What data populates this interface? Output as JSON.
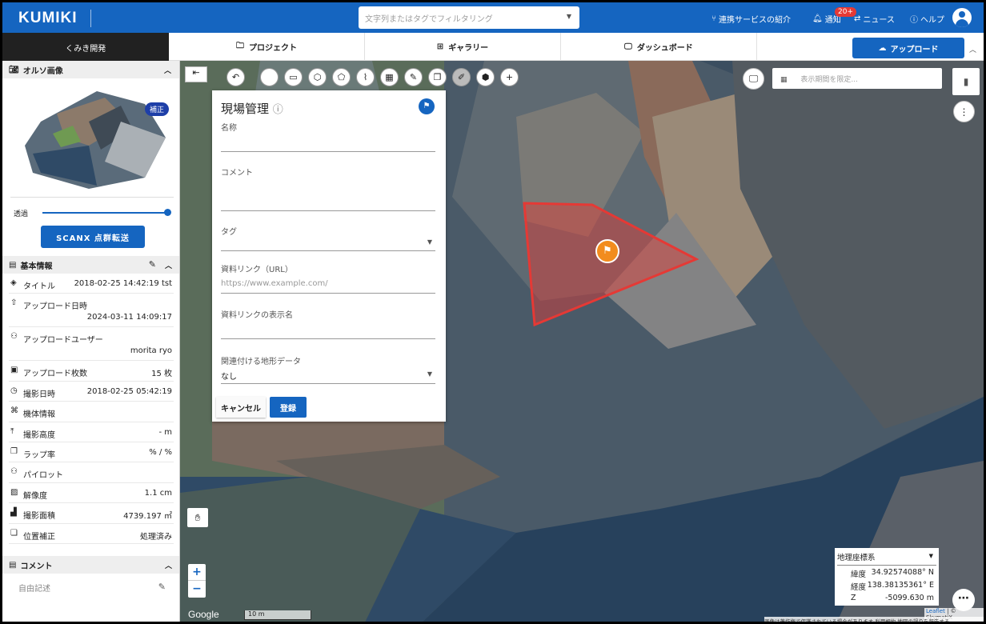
{
  "header": {
    "logo": "KUMIKI",
    "search_placeholder": "文字列またはタグでフィルタリング",
    "links": {
      "services": "連携サービスの紹介",
      "notify": "通知",
      "notify_badge": "20+",
      "news": "ニュース",
      "help": "ヘルプ"
    }
  },
  "nav": {
    "workspace": "くみき開発",
    "tabs": [
      "プロジェクト",
      "ギャラリー",
      "ダッシュボード"
    ],
    "upload": "アップロード"
  },
  "sidebar": {
    "ortho_title": "オルソ画像",
    "ortho_badge": "補正",
    "opacity_label": "透過",
    "opacity_value": 1.0,
    "scanx_label": "SCANX 点群転送",
    "info_title": "基本情報",
    "info_rows": [
      {
        "icon": "layers-icon",
        "label": "タイトル",
        "value": "2018-02-25 14:42:19 tst"
      },
      {
        "icon": "upload-icon",
        "label": "アップロード日時",
        "value": "2024-03-11 14:09:17"
      },
      {
        "icon": "user-icon",
        "label": "アップロードユーザー",
        "value": "morita ryo"
      },
      {
        "icon": "images-icon",
        "label": "アップロード枚数",
        "value": "15 枚"
      },
      {
        "icon": "clock-icon",
        "label": "撮影日時",
        "value": "2018-02-25 05:42:19"
      },
      {
        "icon": "drone-icon",
        "label": "機体情報",
        "value": ""
      },
      {
        "icon": "altitude-icon",
        "label": "撮影高度",
        "value": "- m"
      },
      {
        "icon": "overlap-icon",
        "label": "ラップ率",
        "value": "% / %"
      },
      {
        "icon": "pilot-icon",
        "label": "パイロット",
        "value": ""
      },
      {
        "icon": "resolution-icon",
        "label": "解像度",
        "value": "1.1 cm"
      },
      {
        "icon": "area-icon",
        "label": "撮影面積",
        "value": "4739.197 ㎡"
      },
      {
        "icon": "correction-icon",
        "label": "位置補正",
        "value": "処理済み"
      }
    ],
    "comment_title": "コメント",
    "comment_placeholder": "自由記述"
  },
  "form": {
    "title": "現場管理",
    "name_label": "名称",
    "comment_label": "コメント",
    "tag_label": "タグ",
    "url_label": "資料リンク（URL）",
    "url_placeholder": "https://www.example.com/",
    "link_name_label": "資料リンクの表示名",
    "terrain_label": "関連付ける地形データ",
    "terrain_value": "なし",
    "cancel": "キャンセル",
    "save": "登録"
  },
  "map": {
    "date_placeholder": "表示期間を限定...",
    "google": "Google",
    "scale": "10 m",
    "coord_system": "地理座標系",
    "lat_label": "緯度",
    "lat": "34.92574088° N",
    "lon_label": "経度",
    "lon": "138.38135361° E",
    "z_label": "Z",
    "z": "-5099.630 m",
    "attribution_leaflet": "Leaflet",
    "attribution_rest": " | © SkymatiX",
    "attribution_bottom": "画像は著作権で保護されている場合があります  利用規約  地図の誤りを報告する"
  },
  "colors": {
    "primary": "#1565c0",
    "polygon": "#e53935",
    "pin": "#f28c1e"
  }
}
